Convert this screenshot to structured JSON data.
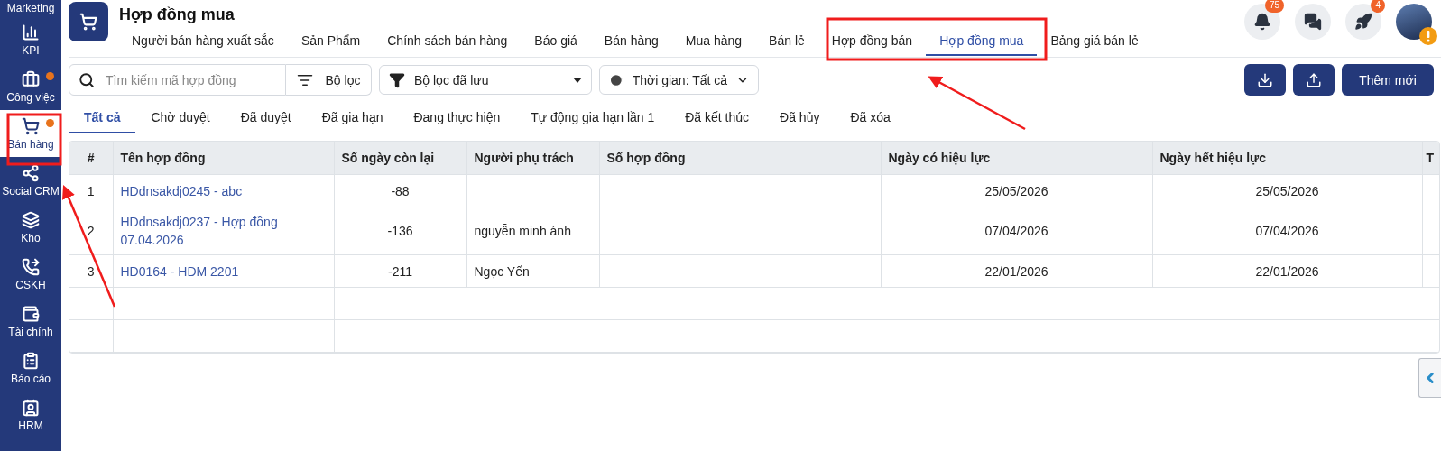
{
  "sidebar": {
    "items": [
      {
        "label": "Marketing",
        "selected": false,
        "dot": false
      },
      {
        "label": "KPI",
        "selected": false,
        "dot": false
      },
      {
        "label": "Công việc",
        "selected": false,
        "dot": true
      },
      {
        "label": "Bán hàng",
        "selected": true,
        "dot": true
      },
      {
        "label": "Social CRM",
        "selected": false,
        "dot": false
      },
      {
        "label": "Kho",
        "selected": false,
        "dot": false
      },
      {
        "label": "CSKH",
        "selected": false,
        "dot": false
      },
      {
        "label": "Tài chính",
        "selected": false,
        "dot": false
      },
      {
        "label": "Báo cáo",
        "selected": false,
        "dot": false
      },
      {
        "label": "HRM",
        "selected": false,
        "dot": false
      }
    ]
  },
  "header": {
    "title": "Hợp đồng mua",
    "nav": [
      {
        "label": "Người bán hàng xuất sắc",
        "selected": false
      },
      {
        "label": "Sản Phẩm",
        "selected": false
      },
      {
        "label": "Chính sách bán hàng",
        "selected": false
      },
      {
        "label": "Báo giá",
        "selected": false
      },
      {
        "label": "Bán hàng",
        "selected": false
      },
      {
        "label": "Mua hàng",
        "selected": false
      },
      {
        "label": "Bán lẻ",
        "selected": false
      },
      {
        "label": "Hợp đồng bán",
        "selected": false
      },
      {
        "label": "Hợp đồng mua",
        "selected": true
      },
      {
        "label": "Bảng giá bán lẻ",
        "selected": false
      }
    ],
    "actions": [
      {
        "kind": "bell",
        "badge": "75"
      },
      {
        "kind": "chat"
      },
      {
        "kind": "rocket",
        "badge": "4"
      }
    ]
  },
  "toolbar": {
    "search": {
      "placeholder": "Tìm kiếm mã hợp đồng"
    },
    "filter_button": "Bộ lọc",
    "saved_filter": {
      "value": "Bộ lọc đã lưu"
    },
    "time_filter": {
      "value": "Thời gian: Tất cả"
    },
    "actions": [
      {
        "kind": "download"
      },
      {
        "kind": "upload"
      },
      {
        "kind": "text",
        "label": "Thêm mới"
      }
    ]
  },
  "status_tabs": [
    {
      "label": "Tất cả",
      "selected": true
    },
    {
      "label": "Chờ duyệt",
      "selected": false
    },
    {
      "label": "Đã duyệt",
      "selected": false
    },
    {
      "label": "Đã gia hạn",
      "selected": false
    },
    {
      "label": "Đang thực hiện",
      "selected": false
    },
    {
      "label": "Tự động gia hạn lần 1",
      "selected": false
    },
    {
      "label": "Đã kết thúc",
      "selected": false
    },
    {
      "label": "Đã hủy",
      "selected": false
    },
    {
      "label": "Đã xóa",
      "selected": false
    }
  ],
  "table": {
    "columns": [
      "#",
      "Tên hợp đồng",
      "Số ngày còn lại",
      "Người phụ trách",
      "Số hợp đồng",
      "Ngày có hiệu lực",
      "Ngày hết hiệu lực",
      "T"
    ],
    "rows": [
      {
        "cells": [
          "1",
          "HDdnsakdj0245 - abc",
          "-88",
          "",
          "",
          "25/05/2026",
          "25/05/2026"
        ]
      },
      {
        "cells": [
          "2",
          "HDdnsakdj0237 - Hợp đồng 07.04.2026",
          "-136",
          "nguyễn minh ánh",
          "",
          "07/04/2026",
          "07/04/2026"
        ]
      },
      {
        "cells": [
          "3",
          "HD0164 - HDM 2201",
          "-211",
          "Ngọc Yến",
          "",
          "22/01/2026",
          "22/01/2026"
        ]
      }
    ]
  }
}
